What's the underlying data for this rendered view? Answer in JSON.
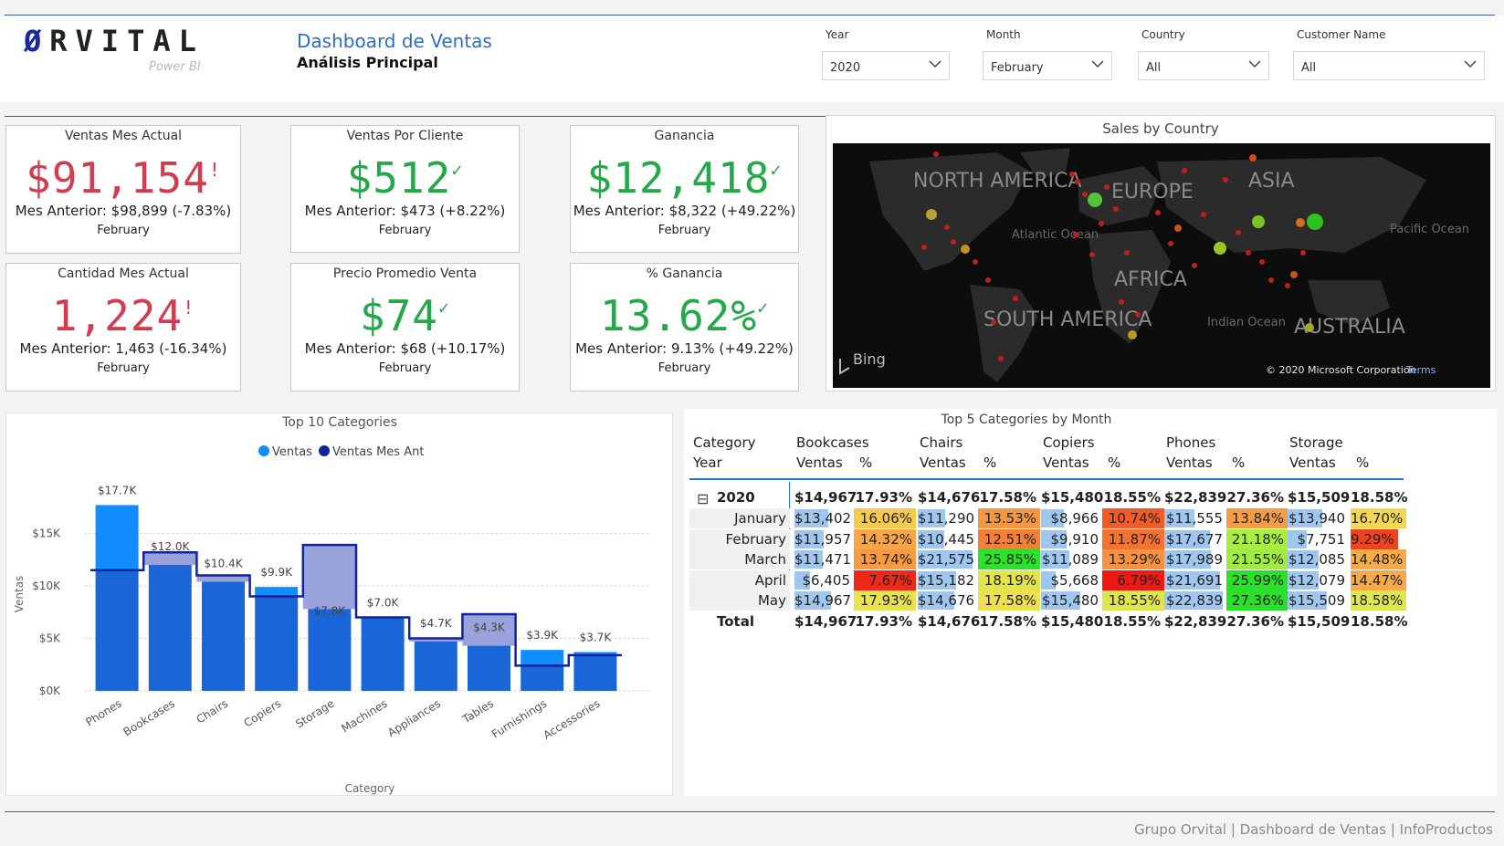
{
  "header": {
    "logo_text": "RVITAL",
    "logo_o": "Ø",
    "logo_sub": "Power BI",
    "title": "Dashboard de Ventas",
    "subtitle": "Análisis Principal"
  },
  "filters": [
    {
      "label": "Year",
      "value": "2020"
    },
    {
      "label": "Month",
      "value": "February"
    },
    {
      "label": "Country",
      "value": "All"
    },
    {
      "label": "Customer Name",
      "value": "All"
    }
  ],
  "kpis": [
    {
      "title": "Ventas Mes Actual",
      "value": "$91,154",
      "mark": "!",
      "status": "red",
      "prev": "Mes Anterior: $98,899 (-7.83%)",
      "month": "February"
    },
    {
      "title": "Ventas Por Cliente",
      "value": "$512",
      "mark": "✓",
      "status": "green",
      "prev": "Mes Anterior: $473 (+8.22%)",
      "month": "February"
    },
    {
      "title": "Ganancia",
      "value": "$12,418",
      "mark": "✓",
      "status": "green",
      "prev": "Mes Anterior: $8,322 (+49.22%)",
      "month": "February"
    },
    {
      "title": "Cantidad Mes Actual",
      "value": "1,224",
      "mark": "!",
      "status": "red",
      "prev": "Mes Anterior: 1,463 (-16.34%)",
      "month": "February"
    },
    {
      "title": "Precio Promedio Venta",
      "value": "$74",
      "mark": "✓",
      "status": "green",
      "prev": "Mes Anterior: $68 (+10.17%)",
      "month": "February"
    },
    {
      "title": "% Ganancia",
      "value": "13.62%",
      "mark": "✓",
      "status": "green",
      "prev": "Mes Anterior: 9.13% (+49.22%)",
      "month": "February"
    }
  ],
  "map": {
    "title": "Sales by Country",
    "labels": {
      "north_america": "NORTH AMERICA",
      "europe": "EUROPE",
      "asia": "ASIA",
      "africa": "AFRICA",
      "south_america": "SOUTH AMERICA",
      "australia": "AUSTRALIA",
      "atlantic": "Atlantic Ocean",
      "pacific": "Pacific Ocean",
      "indian": "Indian Ocean"
    },
    "bing": "Bing",
    "copyright": "© 2020 Microsoft Corporation",
    "terms": "Terms"
  },
  "chart_data": {
    "type": "bar",
    "title": "Top 10 Categories",
    "xlabel": "Category",
    "ylabel": "Ventas",
    "ylim": [
      0,
      20000
    ],
    "yticks": [
      0,
      5000,
      10000,
      15000
    ],
    "ytick_labels": [
      "$0K",
      "$5K",
      "$10K",
      "$15K"
    ],
    "grid": true,
    "legend": "top",
    "categories": [
      "Phones",
      "Bookcases",
      "Chairs",
      "Copiers",
      "Storage",
      "Machines",
      "Appliances",
      "Tables",
      "Furnishings",
      "Accessories"
    ],
    "series": [
      {
        "name": "Ventas",
        "values": [
          17700,
          12000,
          10400,
          9900,
          7800,
          7000,
          4700,
          4300,
          3900,
          3700
        ],
        "labels": [
          "$17.7K",
          "$12.0K",
          "$10.4K",
          "$9.9K",
          "$7.8K",
          "$7.0K",
          "$4.7K",
          "$4.3K",
          "$3.9K",
          "$3.7K"
        ]
      },
      {
        "name": "Ventas Mes Ant",
        "values": [
          11500,
          13200,
          11000,
          9000,
          13900,
          7000,
          5000,
          7300,
          2400,
          3400
        ]
      }
    ],
    "colors": {
      "ventas": "#118dff",
      "ventas_mes_ant": "#12239e",
      "ventas_overlap": "#1a66d8",
      "ventas_ant_fill": "#9aa2dc"
    }
  },
  "matrix": {
    "title": "Top 5 Categories by Month",
    "row_header_1": "Category",
    "row_header_2": "Year",
    "categories": [
      "Bookcases",
      "Chairs",
      "Copiers",
      "Phones",
      "Storage"
    ],
    "sub_headers": [
      "Ventas",
      "%"
    ],
    "collapse_icon": "⊟",
    "year_row": {
      "label": "2020",
      "values": [
        "$14,967",
        "17.93%",
        "$14,676",
        "17.58%",
        "$15,480",
        "18.55%",
        "$22,839",
        "27.36%",
        "$15,509",
        "18.58%"
      ]
    },
    "months": [
      {
        "label": "January",
        "values": [
          "$13,402",
          "16.06%",
          "$11,290",
          "13.53%",
          "$8,966",
          "10.74%",
          "$11,555",
          "13.84%",
          "$13,940",
          "16.70%"
        ],
        "bars": [
          0.6,
          0.49,
          0.39,
          0.51,
          0.61
        ],
        "pcts": [
          16.06,
          13.53,
          10.74,
          13.84,
          16.7
        ]
      },
      {
        "label": "February",
        "values": [
          "$11,957",
          "14.32%",
          "$10,445",
          "12.51%",
          "$9,910",
          "11.87%",
          "$17,677",
          "21.18%",
          "$7,751",
          "9.29%"
        ],
        "bars": [
          0.53,
          0.46,
          0.44,
          0.78,
          0.34
        ],
        "pcts": [
          14.32,
          12.51,
          11.87,
          21.18,
          9.29
        ]
      },
      {
        "label": "March",
        "values": [
          "$11,471",
          "13.74%",
          "$21,575",
          "25.85%",
          "$11,089",
          "13.29%",
          "$17,989",
          "21.55%",
          "$12,085",
          "14.48%"
        ],
        "bars": [
          0.51,
          0.96,
          0.49,
          0.8,
          0.54
        ],
        "pcts": [
          13.74,
          25.85,
          13.29,
          21.55,
          14.48
        ]
      },
      {
        "label": "April",
        "values": [
          "$6,405",
          "7.67%",
          "$15,182",
          "18.19%",
          "$5,668",
          "6.79%",
          "$21,691",
          "25.99%",
          "$12,079",
          "14.47%"
        ],
        "bars": [
          0.28,
          0.67,
          0.25,
          0.96,
          0.54
        ],
        "pcts": [
          7.67,
          18.19,
          6.79,
          25.99,
          14.47
        ]
      },
      {
        "label": "May",
        "values": [
          "$14,967",
          "17.93%",
          "$14,676",
          "17.58%",
          "$15,480",
          "18.55%",
          "$22,839",
          "27.36%",
          "$15,509",
          "18.58%"
        ],
        "bars": [
          0.66,
          0.65,
          0.69,
          1.0,
          0.69
        ],
        "pcts": [
          17.93,
          17.58,
          18.55,
          27.36,
          18.58
        ]
      }
    ],
    "total_row": {
      "label": "Total",
      "values": [
        "$14,967",
        "17.93%",
        "$14,676",
        "17.58%",
        "$15,480",
        "18.55%",
        "$22,839",
        "27.36%",
        "$15,509",
        "18.58%"
      ]
    }
  },
  "footer": "Grupo Orvital | Dashboard de Ventas | InfoProductos"
}
